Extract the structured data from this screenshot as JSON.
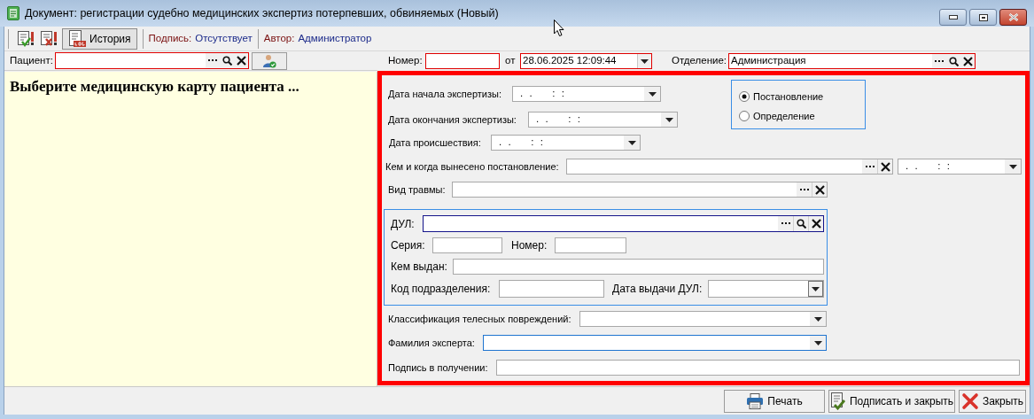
{
  "window": {
    "title": "Документ: регистрации судебно медицинских экспертиз потерпевших, обвиняемых (Новый)"
  },
  "toolbar": {
    "history_button": {
      "label": "История",
      "selected": true
    },
    "signature_label": "Подпись:",
    "signature_value": "Отсутствует",
    "author_label": "Автор:",
    "author_value": "Администратор"
  },
  "patient": {
    "label": "Пациент:",
    "required": true
  },
  "patient_panel": {
    "message": "Выберите медицинскую карту пациента ..."
  },
  "header": {
    "number": {
      "label": "Номер:",
      "required": true
    },
    "date": {
      "label": "от",
      "value": "28.06.2025 12:09:44",
      "required": true
    },
    "department": {
      "label": "Отделение:",
      "value": "Администрация",
      "required": true
    }
  },
  "form": {
    "fields_top": [
      {
        "kind": "date",
        "label": "Дата начала экспертизы:",
        "value": ". .    : :"
      },
      {
        "kind": "date",
        "label": "Дата окончания экспертизы:",
        "value": ". .    : :"
      },
      {
        "kind": "date",
        "label": "Дата происшествия:",
        "value": ". .    : :"
      }
    ],
    "order_type": [
      {
        "label": "Постановление",
        "selected": true
      },
      {
        "label": "Определение",
        "selected": false
      }
    ],
    "fields_middle": [
      {
        "kind": "lookup_date",
        "label": "Кем и когда вынесено постановление:",
        "date_value": ". .    : :"
      },
      {
        "kind": "lookup",
        "label": "Вид травмы:"
      }
    ],
    "identity_document": [
      {
        "kind": "lookup_search",
        "label": "ДУЛ:",
        "focused": true
      },
      {
        "kind": "text",
        "label": "Серия:",
        "focused": false
      },
      {
        "kind": "text",
        "label": "Номер:",
        "focused": false
      },
      {
        "kind": "text",
        "label": "Кем выдан:",
        "focused": false
      },
      {
        "kind": "text",
        "label": "Код подразделения:",
        "focused": false
      },
      {
        "kind": "date_button",
        "label": "Дата выдачи ДУЛ:",
        "focused": false
      }
    ],
    "fields_bottom": [
      {
        "kind": "combo",
        "label": "Классификация телесных повреждений:",
        "focused": false
      },
      {
        "kind": "combo",
        "label": "Фамилия эксперта:",
        "focused": true
      },
      {
        "kind": "text",
        "label": "Подпись в получении:",
        "focused": false
      }
    ]
  },
  "buttons": [
    {
      "kind": "print",
      "label": "Печать"
    },
    {
      "kind": "sign",
      "label": "Подписать и закрыть"
    },
    {
      "kind": "close",
      "label": "Закрыть"
    }
  ]
}
